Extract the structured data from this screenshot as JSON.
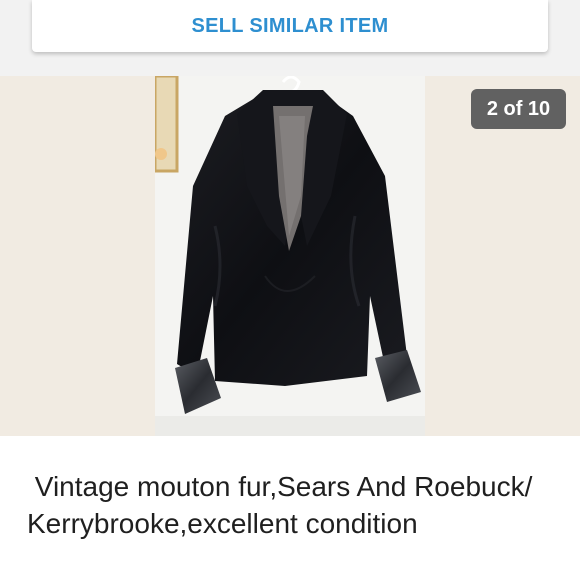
{
  "actions": {
    "sell_similar_label": "SELL SIMILAR ITEM"
  },
  "gallery": {
    "counter": "2 of 10",
    "image_subject": "black faux fur jacket on hanger"
  },
  "listing": {
    "title": " Vintage mouton fur,Sears And Roebuck/ Kerrybrooke,excellent condition"
  },
  "colors": {
    "accent": "#2e8fd0",
    "counter_bg": "#616161",
    "gallery_bg": "#f1ebe2"
  }
}
